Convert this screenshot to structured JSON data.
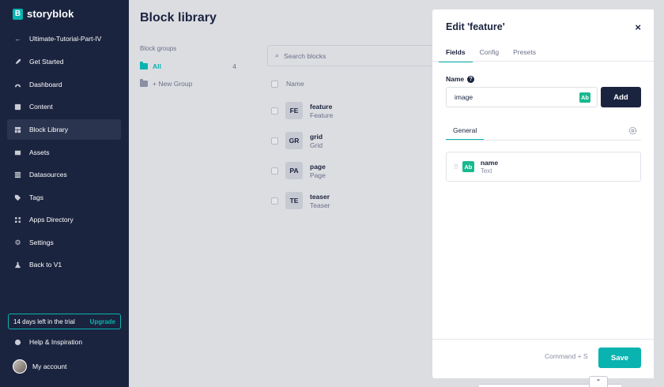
{
  "brand": {
    "name": "storyblok",
    "mark": "B",
    "accent": "#09b3af",
    "navy": "#1b243f"
  },
  "sidebar": {
    "back": {
      "label": "Ultimate-Tutorial-Part-IV",
      "icon": "arrow-left-icon"
    },
    "items": [
      {
        "label": "Get Started",
        "icon": "rocket-icon"
      },
      {
        "label": "Dashboard",
        "icon": "dashboard-icon"
      },
      {
        "label": "Content",
        "icon": "content-icon"
      },
      {
        "label": "Block Library",
        "icon": "blocks-icon",
        "active": true
      },
      {
        "label": "Assets",
        "icon": "image-icon"
      },
      {
        "label": "Datasources",
        "icon": "list-icon"
      },
      {
        "label": "Tags",
        "icon": "tag-icon"
      },
      {
        "label": "Apps Directory",
        "icon": "apps-icon"
      },
      {
        "label": "Settings",
        "icon": "gear-icon"
      },
      {
        "label": "Back to V1",
        "icon": "flask-icon"
      }
    ],
    "trial": {
      "text": "14 days left in the trial",
      "cta": "Upgrade"
    },
    "help": {
      "label": "Help & Inspiration",
      "icon": "lifebuoy-icon"
    },
    "account": {
      "label": "My account"
    }
  },
  "main": {
    "title": "Block library",
    "groups_heading": "Block groups",
    "groups": [
      {
        "label": "All",
        "count": "4",
        "active": true
      },
      {
        "label": "+ New Group"
      }
    ],
    "search_placeholder": "Search blocks",
    "column_name": "Name",
    "blocks": [
      {
        "badge": "FE",
        "name": "feature",
        "type": "Feature"
      },
      {
        "badge": "GR",
        "name": "grid",
        "type": "Grid"
      },
      {
        "badge": "PA",
        "name": "page",
        "type": "Page"
      },
      {
        "badge": "TE",
        "name": "teaser",
        "type": "Teaser"
      }
    ]
  },
  "panel": {
    "title": "Edit 'feature'",
    "close": "×",
    "tabs": [
      "Fields",
      "Config",
      "Presets"
    ],
    "name_label": "Name",
    "name_value": "image",
    "type_badge": "Ab",
    "add_label": "Add",
    "group_tab": "General",
    "fields": [
      {
        "name": "name",
        "type": "Text",
        "badge": "Ab"
      }
    ],
    "shortcut": "Command + S",
    "save_label": "Save"
  }
}
